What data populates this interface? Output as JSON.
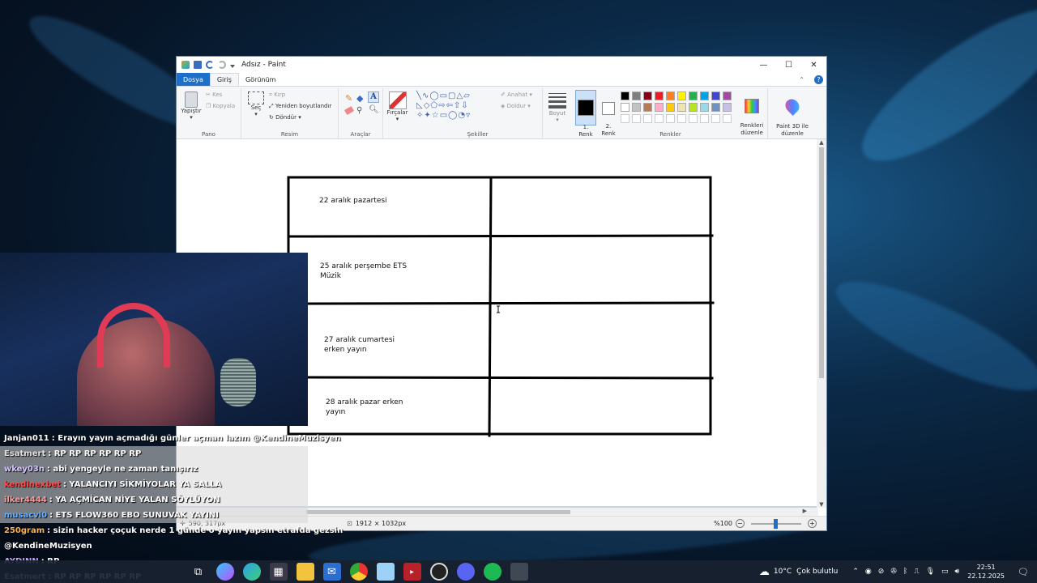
{
  "window": {
    "title": "Adsız - Paint",
    "minimize_icon": "—",
    "maximize_icon": "☐",
    "close_icon": "✕"
  },
  "ribbon": {
    "tabs": [
      {
        "label": "Dosya"
      },
      {
        "label": "Giriş"
      },
      {
        "label": "Görünüm"
      }
    ],
    "clipboard": {
      "paste": "Yapıştır",
      "cut": "Kes",
      "copy": "Kopyala",
      "group": "Pano"
    },
    "image": {
      "select": "Seç",
      "crop": "Kırp",
      "resize": "Yeniden boyutlandır",
      "rotate": "Döndür",
      "group": "Resim"
    },
    "tools": {
      "group": "Araçlar"
    },
    "brushes": {
      "label": "Fırçalar"
    },
    "shapes": {
      "outline": "Anahat",
      "fill": "Doldur",
      "group": "Şekiller"
    },
    "size": {
      "label": "Boyut"
    },
    "colors": {
      "color1": "1.\nRenk",
      "color2": "2.\nRenk",
      "edit": "Renkleri\ndüzenle",
      "paint3d": "Paint 3D ile\ndüzenle",
      "group": "Renkler",
      "palette_row1": [
        "#000000",
        "#7f7f7f",
        "#880015",
        "#ed1c24",
        "#ff7f27",
        "#fff200",
        "#22b14c",
        "#00a2e8",
        "#3f48cc",
        "#a349a4"
      ],
      "palette_row2": [
        "#ffffff",
        "#c3c3c3",
        "#b97a57",
        "#ffaec9",
        "#ffc90e",
        "#efe4b0",
        "#b5e61d",
        "#99d9ea",
        "#7092be",
        "#c8bfe7"
      ]
    }
  },
  "canvas": {
    "cells": [
      "22 aralık pazartesi",
      "25 aralık perşembe ETS\nMüzik",
      "27 aralık cumartesi\nerken yayın",
      "28 aralık pazar erken\nyayın"
    ]
  },
  "statusbar": {
    "cursor_pos": "590, 317px",
    "canvas_size": "1912 × 1032px",
    "zoom": "%100",
    "zoom_minus": "−",
    "zoom_plus": "+"
  },
  "chat": [
    {
      "user": "Janjan011",
      "color": "#ffffff",
      "msg": ": Erayın yayın açmadığı günler açman lazım @KendineMuzisyen",
      "boxed": false
    },
    {
      "user": "Esatmert",
      "color": "#e0e0e0",
      "msg": ": RP RP RP RP RP RP",
      "boxed": true
    },
    {
      "user": "wkey03n",
      "color": "#d7c4ff",
      "msg": ": abi yengeyle ne zaman tanışırız",
      "boxed": true
    },
    {
      "user": "kendinexbet",
      "color": "#ff4d4d",
      "msg": ": YALANCIYI SİKMİYOLAR YA SALLA",
      "boxed": true
    },
    {
      "user": "ilker4444",
      "color": "#ff9a9a",
      "msg": ": YA AÇMİCAN NİYE YALAN SÖYLÜYON",
      "boxed": true
    },
    {
      "user": "musacvl0",
      "color": "#6ab0ff",
      "msg": ": ETS FLOW360 EBO SUNUVAK YAYINI",
      "boxed": true
    },
    {
      "user": "250gram",
      "color": "#ffb347",
      "msg": ": sizin hacker çoçuk nerde 1 günde o yayın yapsın etrafda gezsin",
      "boxed": false
    },
    {
      "user": "",
      "color": "#ffffff",
      "msg": "@KendineMuzisyen",
      "boxed": false
    },
    {
      "user": "AYDINN",
      "color": "#c99cff",
      "msg": ": RP",
      "boxed": false
    },
    {
      "user": "Esatmert",
      "color": "#e0e0e0",
      "msg": ": RP RP RP RP RP RP",
      "boxed": false
    }
  ],
  "taskbar": {
    "weather_temp": "10°C",
    "weather_desc": "Çok bulutlu",
    "time": "22:51",
    "date": "22.12.2025"
  }
}
